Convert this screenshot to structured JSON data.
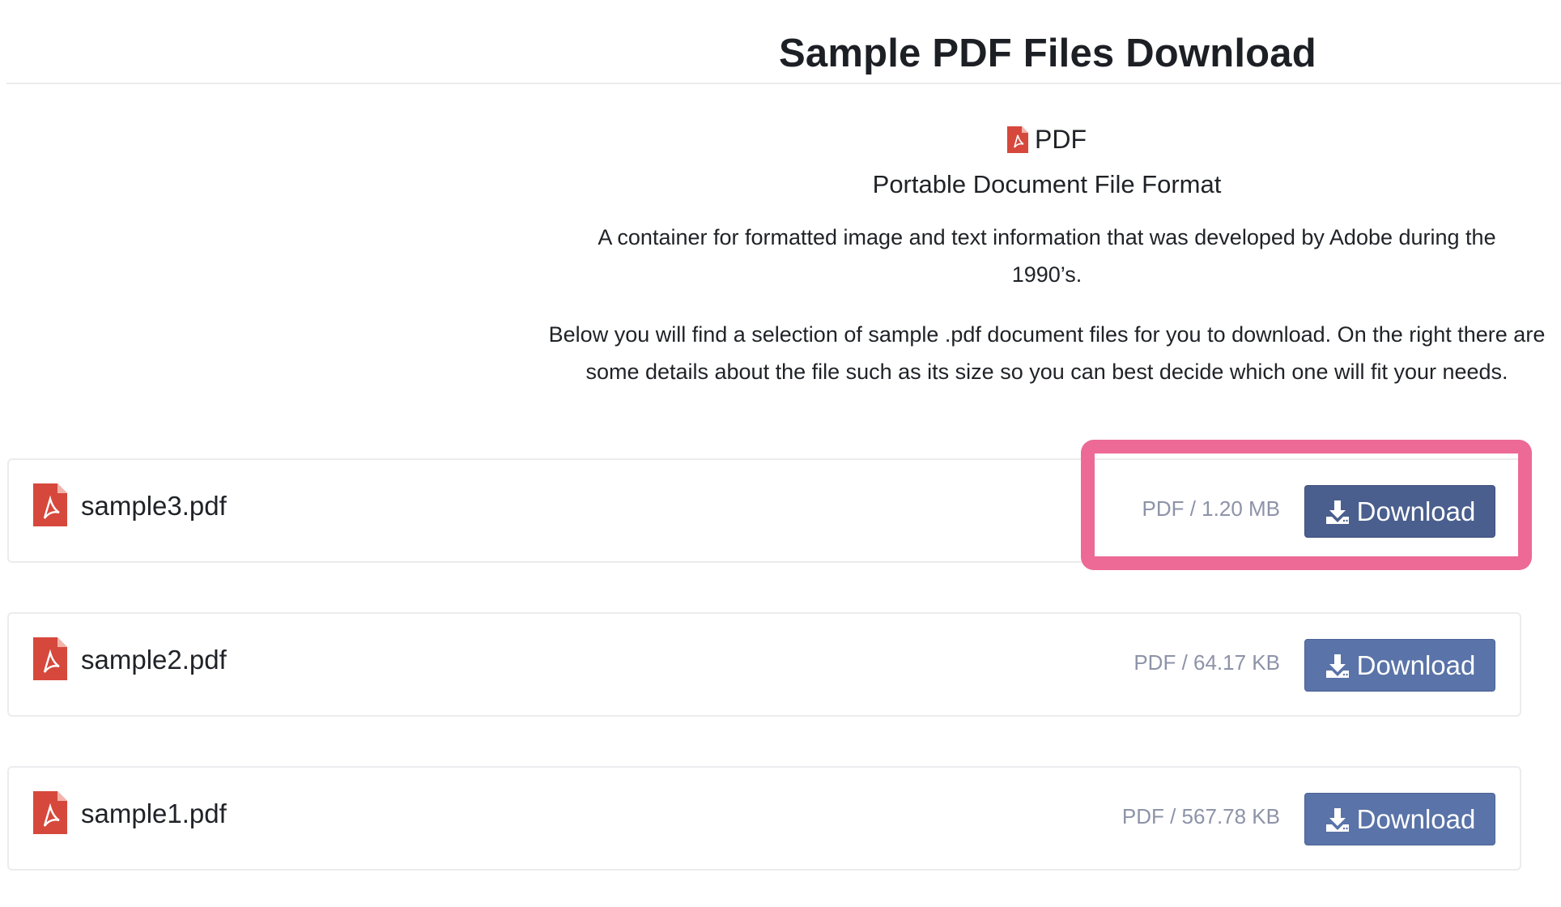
{
  "header": {
    "title": "Sample PDF Files Download"
  },
  "intro": {
    "format_label": "PDF",
    "format_icon": "pdf-file-icon",
    "format_fullname": "Portable Document File Format",
    "description": "A container for formatted image and text information that was developed by Adobe during the 1990’s.",
    "text": "Below you will find a selection of sample .pdf document files for you to download. On the right there are some details about the file such as its size so you can best decide which one will fit your needs."
  },
  "files": [
    {
      "name": "sample3.pdf",
      "meta": "PDF / 1.20 MB",
      "button_label": "Download"
    },
    {
      "name": "sample2.pdf",
      "meta": "PDF / 64.17 KB",
      "button_label": "Download"
    },
    {
      "name": "sample1.pdf",
      "meta": "PDF / 567.78 KB",
      "button_label": "Download"
    }
  ],
  "colors": {
    "pdf_red": "#d6483c",
    "button_blue": "#5a73a8",
    "button_blue_active": "#4a5f8e",
    "highlight_pink": "#ec6a95",
    "meta_gray": "#8d93a8"
  }
}
